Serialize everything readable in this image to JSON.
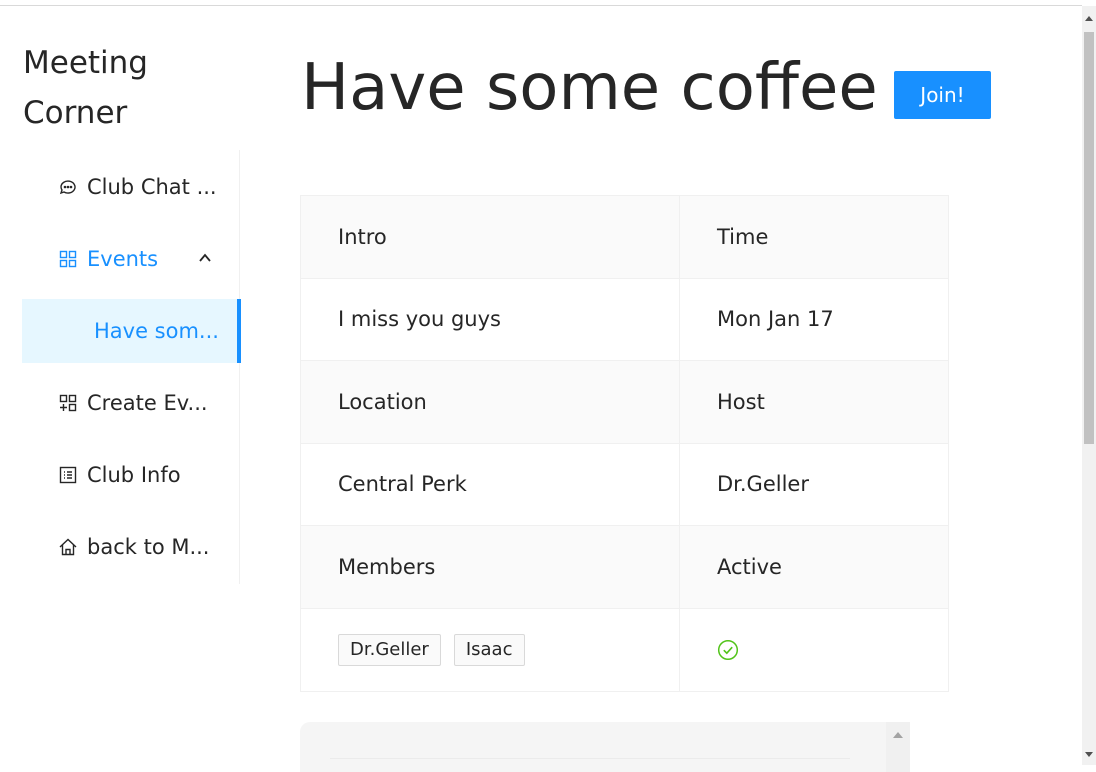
{
  "app": {
    "title": "Meeting Corner"
  },
  "sidebar": {
    "items": [
      {
        "label": "Club Chat ...",
        "icon": "chat-bubbles-icon"
      },
      {
        "label": "Events",
        "icon": "grid-icon",
        "expanded": true
      },
      {
        "label": "Have som...",
        "selected": true
      },
      {
        "label": "Create Ev...",
        "icon": "grid-plus-icon"
      },
      {
        "label": "Club Info",
        "icon": "list-box-icon"
      },
      {
        "label": "back to M...",
        "icon": "home-icon"
      }
    ]
  },
  "event": {
    "title": "Have some coffee",
    "join_label": "Join!",
    "details": {
      "intro_label": "Intro",
      "intro_value": "I miss you guys",
      "time_label": "Time",
      "time_value": "Mon Jan 17",
      "location_label": "Location",
      "location_value": "Central Perk",
      "host_label": "Host",
      "host_value": "Dr.Geller",
      "members_label": "Members",
      "members": [
        "Dr.Geller",
        "Isaac"
      ],
      "active_label": "Active",
      "active_value": true
    }
  },
  "colors": {
    "accent": "#1890ff",
    "selected_bg": "#e6f7ff",
    "success": "#52c41a"
  }
}
